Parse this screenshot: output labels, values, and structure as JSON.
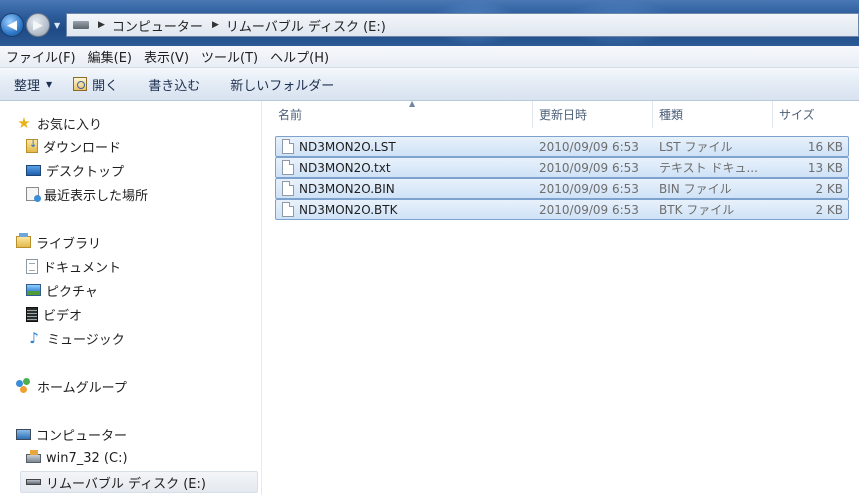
{
  "address": {
    "crumbs": [
      "コンピューター",
      "リムーバブル ディスク (E:)"
    ]
  },
  "menu": [
    "ファイル(F)",
    "編集(E)",
    "表示(V)",
    "ツール(T)",
    "ヘルプ(H)"
  ],
  "toolbar": {
    "organize": "整理",
    "open": "開く",
    "burn": "書き込む",
    "new_folder": "新しいフォルダー"
  },
  "nav": {
    "favorites": "お気に入り",
    "downloads": "ダウンロード",
    "desktop": "デスクトップ",
    "recent": "最近表示した場所",
    "libraries": "ライブラリ",
    "documents": "ドキュメント",
    "pictures": "ピクチャ",
    "videos": "ビデオ",
    "music": "ミュージック",
    "homegroup": "ホームグループ",
    "computer": "コンピューター",
    "drive_c": "win7_32 (C:)",
    "drive_e": "リムーバブル ディスク (E:)"
  },
  "columns": {
    "name": "名前",
    "date": "更新日時",
    "type": "種類",
    "size": "サイズ"
  },
  "files": [
    {
      "name": "ND3MON2O.LST",
      "date": "2010/09/09 6:53",
      "type": "LST ファイル",
      "size": "16 KB"
    },
    {
      "name": "ND3MON2O.txt",
      "date": "2010/09/09 6:53",
      "type": "テキスト ドキュ...",
      "size": "13 KB"
    },
    {
      "name": "ND3MON2O.BIN",
      "date": "2010/09/09 6:53",
      "type": "BIN ファイル",
      "size": "2 KB"
    },
    {
      "name": "ND3MON2O.BTK",
      "date": "2010/09/09 6:53",
      "type": "BTK ファイル",
      "size": "2 KB"
    }
  ]
}
